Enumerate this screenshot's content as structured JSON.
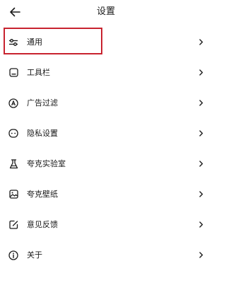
{
  "header": {
    "title": "设置",
    "back_icon": "arrow-left-icon"
  },
  "colors": {
    "highlight": "#c8232f",
    "text": "#1a1a1a"
  },
  "menu": {
    "items": [
      {
        "label": "通用",
        "icon": "sliders-icon"
      },
      {
        "label": "工具栏",
        "icon": "toolbar-icon"
      },
      {
        "label": "广告过滤",
        "icon": "ad-filter-icon"
      },
      {
        "label": "隐私设置",
        "icon": "privacy-icon"
      },
      {
        "label": "夸克实验室",
        "icon": "flask-icon"
      },
      {
        "label": "夸克壁纸",
        "icon": "wallpaper-icon"
      },
      {
        "label": "意见反馈",
        "icon": "feedback-icon"
      },
      {
        "label": "关于",
        "icon": "info-icon"
      }
    ]
  }
}
